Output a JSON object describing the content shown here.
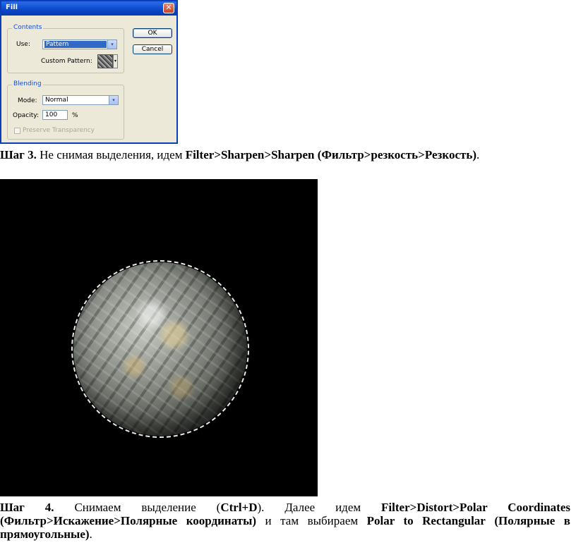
{
  "dialog": {
    "title": "Fill",
    "close_glyph": "✕",
    "contents_legend": "Contents",
    "use_label": "Use:",
    "use_value": "Pattern",
    "custom_pattern_label": "Custom Pattern:",
    "blending_legend": "Blending",
    "mode_label": "Mode:",
    "mode_value": "Normal",
    "opacity_label": "Opacity:",
    "opacity_value": "100",
    "opacity_unit": "%",
    "preserve_label": "Preserve Transparency",
    "ok_label": "OK",
    "cancel_label": "Cancel",
    "dropdown_glyph": "▾"
  },
  "step3": {
    "prefix": "Шаг 3.",
    "text": " Не снимая выделения, идем ",
    "path": "Filter>Sharpen>Sharpen",
    "path_ru": "(Фильтр>резкость>Резкость)",
    "end": "."
  },
  "step4": {
    "prefix": "Шаг 4.",
    "text1": " Снимаем выделение (",
    "shortcut": "Ctrl+D",
    "text2": "). Далее идем ",
    "path": "Filter>Distort>Polar Coordinates",
    "path_ru": "(Фильтр>Искажение>Полярные координаты)",
    "text3": " и там выбираем ",
    "option": "Polar to Rectangular",
    "option_ru": "(Полярные в прямоугольные)",
    "end": "."
  }
}
